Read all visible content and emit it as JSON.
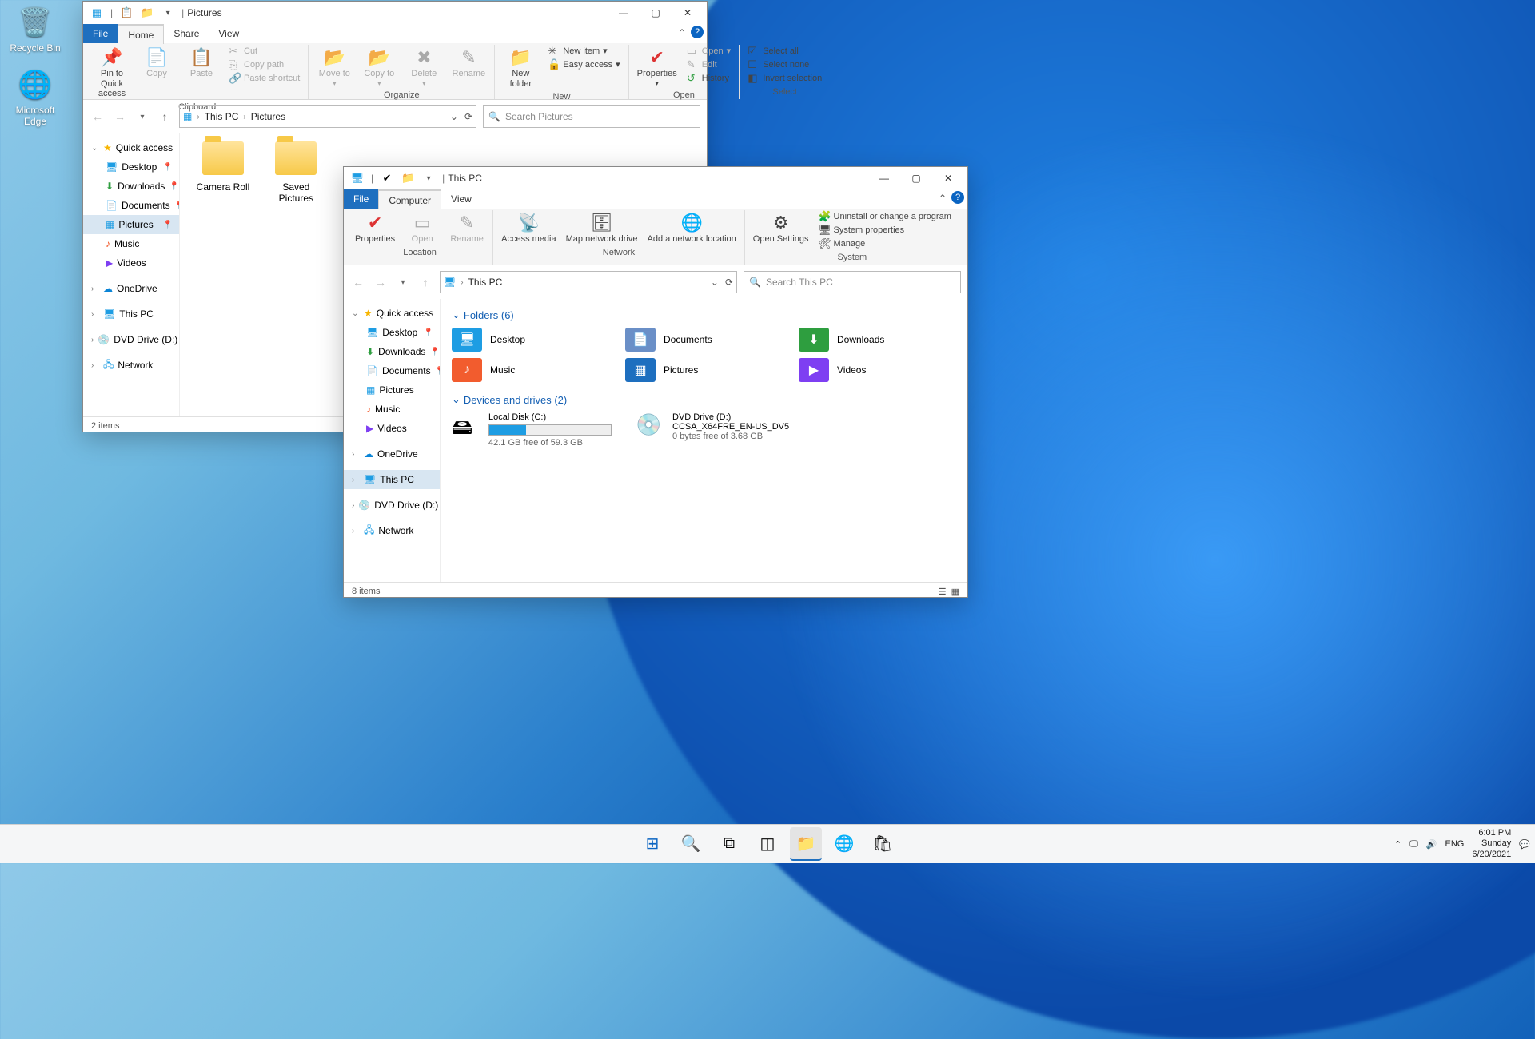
{
  "desktop": {
    "recycle": "Recycle Bin",
    "edge": "Microsoft Edge"
  },
  "win1": {
    "title": "Pictures",
    "tabs": {
      "file": "File",
      "home": "Home",
      "share": "Share",
      "view": "View"
    },
    "ribbon": {
      "pin": "Pin to Quick access",
      "copy": "Copy",
      "paste": "Paste",
      "cut": "Cut",
      "copypath": "Copy path",
      "pasteshort": "Paste shortcut",
      "moveto": "Move to",
      "copyto": "Copy to",
      "delete": "Delete",
      "rename": "Rename",
      "newfolder": "New folder",
      "newitem": "New item",
      "easyaccess": "Easy access",
      "properties": "Properties",
      "open": "Open",
      "edit": "Edit",
      "history": "History",
      "selectall": "Select all",
      "selectnone": "Select none",
      "invert": "Invert selection",
      "g_clipboard": "Clipboard",
      "g_organize": "Organize",
      "g_new": "New",
      "g_open": "Open",
      "g_select": "Select"
    },
    "breadcrumb": {
      "root": "This PC",
      "cur": "Pictures"
    },
    "search_ph": "Search Pictures",
    "nav": {
      "quick": "Quick access",
      "desktop": "Desktop",
      "downloads": "Downloads",
      "documents": "Documents",
      "pictures": "Pictures",
      "music": "Music",
      "videos": "Videos",
      "onedrive": "OneDrive",
      "thispc": "This PC",
      "dvd": "DVD Drive (D:) CCSA",
      "network": "Network"
    },
    "folders": {
      "camera": "Camera Roll",
      "saved": "Saved Pictures"
    },
    "status": "2 items"
  },
  "win2": {
    "title": "This PC",
    "tabs": {
      "file": "File",
      "computer": "Computer",
      "view": "View"
    },
    "ribbon": {
      "properties": "Properties",
      "open": "Open",
      "rename": "Rename",
      "access": "Access media",
      "map": "Map network drive",
      "addnet": "Add a network location",
      "opensettings": "Open Settings",
      "uninstall": "Uninstall or change a program",
      "sysprops": "System properties",
      "manage": "Manage",
      "g_location": "Location",
      "g_network": "Network",
      "g_system": "System"
    },
    "breadcrumb": {
      "cur": "This PC"
    },
    "search_ph": "Search This PC",
    "nav": {
      "quick": "Quick access",
      "desktop": "Desktop",
      "downloads": "Downloads",
      "documents": "Documents",
      "pictures": "Pictures",
      "music": "Music",
      "videos": "Videos",
      "onedrive": "OneDrive",
      "thispc": "This PC",
      "dvd": "DVD Drive (D:) CCSA",
      "network": "Network"
    },
    "sections": {
      "folders": "Folders (6)",
      "drives": "Devices and drives (2)"
    },
    "folders": {
      "desktop": "Desktop",
      "documents": "Documents",
      "downloads": "Downloads",
      "music": "Music",
      "pictures": "Pictures",
      "videos": "Videos"
    },
    "drives": {
      "c_name": "Local Disk (C:)",
      "c_free": "42.1 GB free of 59.3 GB",
      "c_pct": 30,
      "d_name": "DVD Drive (D:)",
      "d_sub": "CCSA_X64FRE_EN-US_DV5",
      "d_free": "0 bytes free of 3.68 GB"
    },
    "status": "8 items"
  },
  "taskbar": {
    "lang": "ENG",
    "time": "6:01 PM",
    "day": "Sunday",
    "date": "6/20/2021"
  }
}
